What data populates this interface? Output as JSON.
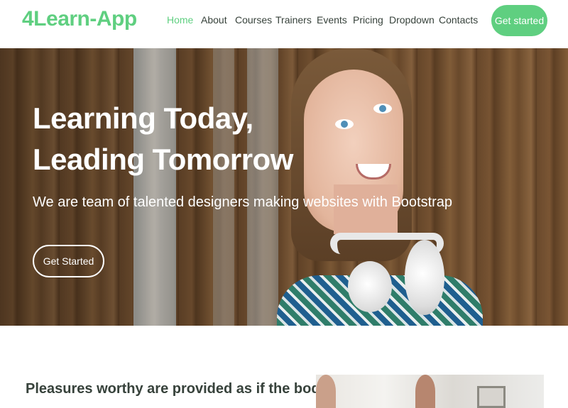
{
  "header": {
    "logo": "4Learn-App",
    "nav": [
      {
        "label": "Home",
        "active": true
      },
      {
        "label": "About",
        "active": false
      },
      {
        "label": "Courses",
        "active": false
      },
      {
        "label": "Trainers",
        "active": false
      },
      {
        "label": "Events",
        "active": false
      },
      {
        "label": "Pricing",
        "active": false
      },
      {
        "label": "Dropdown",
        "active": false
      },
      {
        "label": "Contacts",
        "active": false
      }
    ],
    "cta_label": "Get started"
  },
  "hero": {
    "title_line1": "Learning Today,",
    "title_line2": "Leading Tomorrow",
    "subtitle": "We are team of talented designers making websites with Bootstrap",
    "button_label": "Get Started",
    "image": "student-with-headphones-photo"
  },
  "about": {
    "title": "Pleasures worthy are provided as if the body's",
    "image": "team-office-photo"
  },
  "colors": {
    "accent": "#5fcf80",
    "text": "#37423b",
    "white": "#ffffff"
  }
}
